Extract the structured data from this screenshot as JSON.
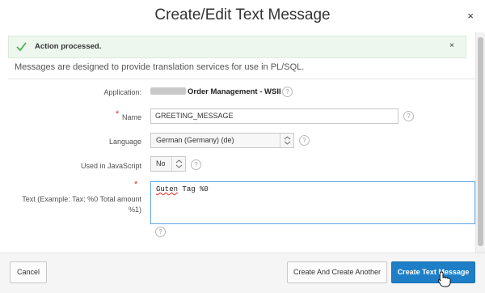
{
  "dialog": {
    "title": "Create/Edit Text Message",
    "close_glyph": "×"
  },
  "alert": {
    "message": "Action processed.",
    "close_glyph": "×",
    "color": "#4caf50"
  },
  "intro": "Messages are designed to provide translation services for use in PL/SQL.",
  "form": {
    "application": {
      "label": "Application:",
      "value": "Order Management - WSII"
    },
    "name": {
      "label": "Name",
      "value": "GREETING_MESSAGE"
    },
    "language": {
      "label": "Language",
      "value": "German (Germany) (de)"
    },
    "used_in_js": {
      "label": "Used in JavaScript",
      "value": "No"
    },
    "text": {
      "label_line1": "Text (Example: Tax: %0 Total amount",
      "label_line2": "%1)",
      "value_word1": "Guten",
      "value_rest": " Tag %0"
    },
    "required_marker": "*",
    "help_glyph": "?"
  },
  "footer": {
    "cancel_label": "Cancel",
    "create_another_label": "Create And Create Another",
    "create_label": "Create Text Message"
  },
  "colors": {
    "primary": "#1e7ec6",
    "required": "#e5341d",
    "focus": "#5fa7e6"
  }
}
